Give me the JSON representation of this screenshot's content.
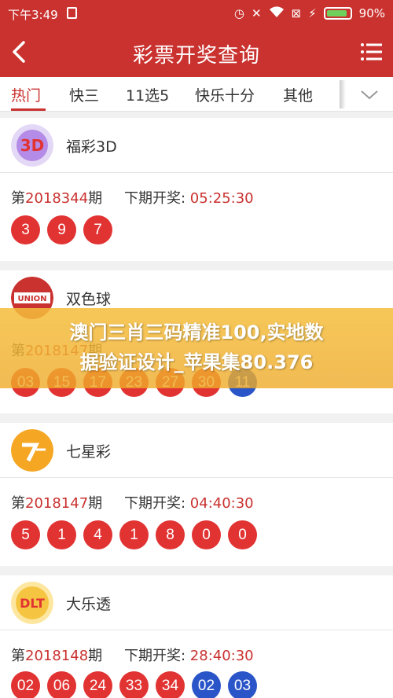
{
  "status_bar": {
    "time": "下午3:49",
    "battery": "90%"
  },
  "header": {
    "title": "彩票开奖查询"
  },
  "tabs": [
    {
      "label": "热门"
    },
    {
      "label": "快三"
    },
    {
      "label": "11选5"
    },
    {
      "label": "快乐十分"
    },
    {
      "label": "其他"
    }
  ],
  "lotteries": [
    {
      "name": "福彩3D",
      "issue_prefix": "第",
      "issue": "2018344",
      "issue_suffix": "期",
      "next_label": "下期开奖: ",
      "next_time": "05:25:30",
      "balls": [
        {
          "n": "3",
          "c": "red"
        },
        {
          "n": "9",
          "c": "red"
        },
        {
          "n": "7",
          "c": "red"
        }
      ]
    },
    {
      "name": "双色球",
      "issue_prefix": "第",
      "issue": "2018147",
      "issue_suffix": "期",
      "balls": [
        {
          "n": "03",
          "c": "red"
        },
        {
          "n": "15",
          "c": "red"
        },
        {
          "n": "17",
          "c": "red"
        },
        {
          "n": "23",
          "c": "red"
        },
        {
          "n": "27",
          "c": "red"
        },
        {
          "n": "30",
          "c": "red"
        },
        {
          "n": "11",
          "c": "blue"
        }
      ]
    },
    {
      "name": "七星彩",
      "issue_prefix": "第",
      "issue": "2018147",
      "issue_suffix": "期",
      "next_label": "下期开奖: ",
      "next_time": "04:40:30",
      "balls": [
        {
          "n": "5",
          "c": "red"
        },
        {
          "n": "1",
          "c": "red"
        },
        {
          "n": "4",
          "c": "red"
        },
        {
          "n": "1",
          "c": "red"
        },
        {
          "n": "8",
          "c": "red"
        },
        {
          "n": "0",
          "c": "red"
        },
        {
          "n": "0",
          "c": "red"
        }
      ]
    },
    {
      "name": "大乐透",
      "issue_prefix": "第",
      "issue": "2018148",
      "issue_suffix": "期",
      "next_label": "下期开奖: ",
      "next_time": "28:40:30",
      "balls": [
        {
          "n": "02",
          "c": "red"
        },
        {
          "n": "06",
          "c": "red"
        },
        {
          "n": "24",
          "c": "red"
        },
        {
          "n": "33",
          "c": "red"
        },
        {
          "n": "34",
          "c": "red"
        },
        {
          "n": "02",
          "c": "blue"
        },
        {
          "n": "03",
          "c": "blue"
        }
      ]
    }
  ],
  "banner": {
    "line1": "澳门三肖三码精准100,实地数",
    "line2": "据验证设计_苹果集80.376"
  },
  "colors": {
    "brand_red": "#c9322f",
    "ball_red": "#e23333",
    "ball_blue": "#2a55c8",
    "banner": "#f2b43c"
  }
}
